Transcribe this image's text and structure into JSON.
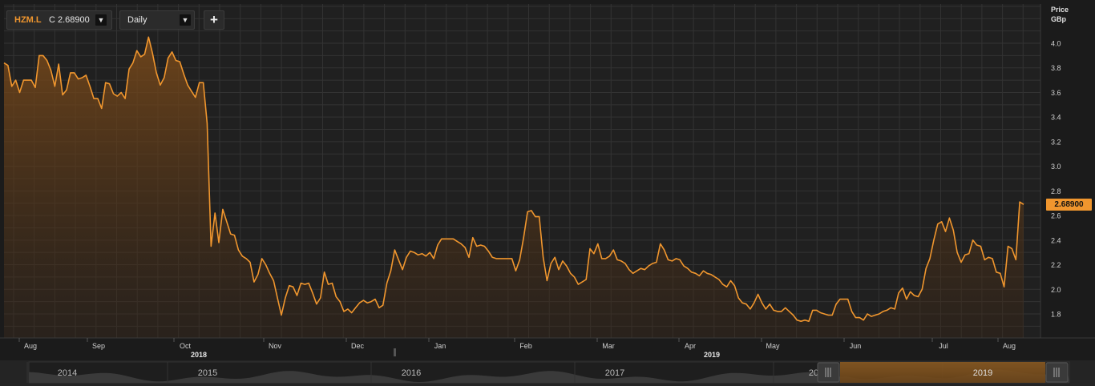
{
  "toolbar": {
    "symbol": "HZM.L",
    "close_text": "C 2.68900",
    "interval": "Daily",
    "add_label": "+"
  },
  "axis": {
    "price_label": "Price",
    "unit_label": "GBp"
  },
  "last_price_label": "2.68900",
  "colors": {
    "background": "#1b1b1b",
    "line": "#f0962e",
    "grid": "#333333",
    "text": "#d0d0d0"
  },
  "chart_data": {
    "type": "area",
    "title": "",
    "ylabel": "Price GBp",
    "xlabel": "",
    "ylim": [
      1.65,
      4.1
    ],
    "y_ticks": [
      "1.8",
      "2.0",
      "2.2",
      "2.4",
      "2.6",
      "2.8",
      "3.0",
      "3.2",
      "3.4",
      "3.6",
      "3.8",
      "4.0"
    ],
    "x_ticks": [
      "Aug",
      "Sep",
      "Oct",
      "Nov",
      "Dec",
      "Jan",
      "Feb",
      "Mar",
      "Apr",
      "May",
      "Jun",
      "Jul",
      "Aug"
    ],
    "x_year_labels": [
      "2018",
      "2019"
    ],
    "grid": true,
    "last_value": 2.689,
    "series": [
      {
        "values": [
          3.84,
          3.82,
          3.65,
          3.7,
          3.6,
          3.7,
          3.7,
          3.7,
          3.64,
          3.9,
          3.9,
          3.86,
          3.78,
          3.65,
          3.83,
          3.58,
          3.62,
          3.76,
          3.76,
          3.71,
          3.72,
          3.74,
          3.65,
          3.55,
          3.55,
          3.47,
          3.68,
          3.67,
          3.59,
          3.57,
          3.6,
          3.55,
          3.79,
          3.84,
          3.94,
          3.89,
          3.91,
          4.05,
          3.92,
          3.76,
          3.66,
          3.72,
          3.88,
          3.93,
          3.86,
          3.85,
          3.75,
          3.66,
          3.61,
          3.56,
          3.68,
          3.68,
          3.35,
          2.35,
          2.62,
          2.38,
          2.65,
          2.55,
          2.45,
          2.44,
          2.32,
          2.27,
          2.25,
          2.22,
          2.06,
          2.12,
          2.25,
          2.2,
          2.13,
          2.07,
          1.93,
          1.79,
          1.93,
          2.03,
          2.02,
          1.95,
          2.05,
          2.04,
          2.05,
          1.97,
          1.88,
          1.93,
          2.14,
          2.04,
          2.05,
          1.94,
          1.9,
          1.82,
          1.84,
          1.81,
          1.85,
          1.89,
          1.91,
          1.89,
          1.9,
          1.92,
          1.85,
          1.87,
          2.05,
          2.15,
          2.32,
          2.24,
          2.16,
          2.26,
          2.31,
          2.3,
          2.28,
          2.29,
          2.27,
          2.3,
          2.25,
          2.36,
          2.41,
          2.41,
          2.41,
          2.41,
          2.39,
          2.37,
          2.34,
          2.26,
          2.42,
          2.35,
          2.36,
          2.35,
          2.31,
          2.26,
          2.25,
          2.25,
          2.25,
          2.25,
          2.25,
          2.15,
          2.24,
          2.42,
          2.63,
          2.64,
          2.59,
          2.59,
          2.26,
          2.07,
          2.21,
          2.26,
          2.16,
          2.23,
          2.19,
          2.13,
          2.1,
          2.04,
          2.06,
          2.08,
          2.33,
          2.29,
          2.37,
          2.25,
          2.25,
          2.27,
          2.32,
          2.24,
          2.23,
          2.21,
          2.16,
          2.13,
          2.15,
          2.17,
          2.16,
          2.19,
          2.21,
          2.22,
          2.37,
          2.32,
          2.24,
          2.23,
          2.25,
          2.24,
          2.19,
          2.17,
          2.14,
          2.13,
          2.11,
          2.15,
          2.13,
          2.12,
          2.1,
          2.08,
          2.04,
          2.02,
          2.07,
          2.03,
          1.93,
          1.89,
          1.88,
          1.84,
          1.89,
          1.96,
          1.89,
          1.84,
          1.88,
          1.83,
          1.82,
          1.82,
          1.85,
          1.82,
          1.79,
          1.75,
          1.74,
          1.75,
          1.74,
          1.83,
          1.83,
          1.81,
          1.8,
          1.79,
          1.79,
          1.88,
          1.92,
          1.92,
          1.92,
          1.82,
          1.77,
          1.77,
          1.75,
          1.8,
          1.78,
          1.79,
          1.8,
          1.82,
          1.83,
          1.85,
          1.84,
          1.97,
          2.01,
          1.92,
          1.98,
          1.95,
          1.94,
          2.0,
          2.17,
          2.25,
          2.4,
          2.53,
          2.55,
          2.47,
          2.58,
          2.48,
          2.3,
          2.22,
          2.28,
          2.29,
          2.4,
          2.36,
          2.35,
          2.24,
          2.26,
          2.25,
          2.14,
          2.13,
          2.02,
          2.35,
          2.33,
          2.24,
          2.71,
          2.69
        ]
      }
    ]
  },
  "navigator": {
    "year_labels": [
      "2014",
      "2015",
      "2016",
      "2017",
      "20",
      "2019"
    ],
    "handle_left_icon": "grip-icon",
    "handle_right_icon": "grip-icon"
  }
}
